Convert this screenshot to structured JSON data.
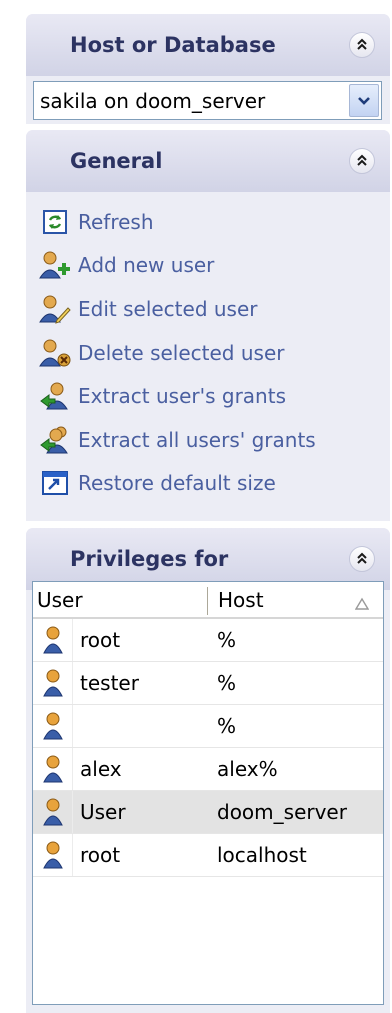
{
  "colors": {
    "panel_bg": "#ecedf5",
    "header_title": "#2c3362",
    "action_link": "#4a5fa0",
    "selected_row": "#e3e3e3"
  },
  "host_panel": {
    "title": "Host or Database",
    "collapse_icon": "double-chevron-up-icon",
    "database_select": {
      "selected_value": "sakila on doom_server",
      "dropdown_icon": "chevron-down-icon"
    }
  },
  "general_panel": {
    "title": "General",
    "collapse_icon": "double-chevron-up-icon",
    "actions": [
      {
        "label": "Refresh",
        "icon": "refresh-icon"
      },
      {
        "label": "Add new user",
        "icon": "add-user-icon"
      },
      {
        "label": "Edit selected user",
        "icon": "edit-user-icon"
      },
      {
        "label": "Delete selected user",
        "icon": "delete-user-icon"
      },
      {
        "label": "Extract user's grants",
        "icon": "extract-grants-icon"
      },
      {
        "label": "Extract all users' grants",
        "icon": "extract-all-grants-icon"
      },
      {
        "label": "Restore default size",
        "icon": "restore-size-icon"
      }
    ]
  },
  "privileges_panel": {
    "title": "Privileges for",
    "collapse_icon": "double-chevron-up-icon",
    "grid": {
      "columns": [
        "User",
        "Host"
      ],
      "sort_icon": "sort-ascending-icon",
      "rows": [
        {
          "user": "root",
          "host": "%",
          "icon": "user-icon",
          "selected": false
        },
        {
          "user": "tester",
          "host": "%",
          "icon": "user-icon",
          "selected": false
        },
        {
          "user": "",
          "host": "%",
          "icon": "user-icon",
          "selected": false
        },
        {
          "user": "alex",
          "host": "alex%",
          "icon": "user-icon",
          "selected": false
        },
        {
          "user": "User",
          "host": "doom_server",
          "icon": "user-icon",
          "selected": true
        },
        {
          "user": "root",
          "host": "localhost",
          "icon": "user-icon",
          "selected": false
        }
      ]
    }
  }
}
